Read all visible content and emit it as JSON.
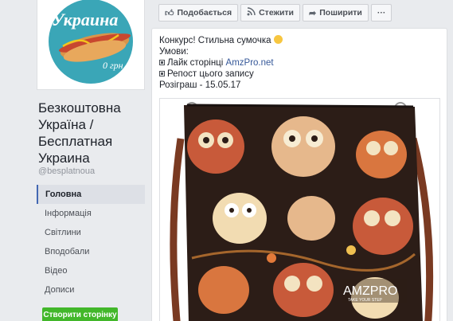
{
  "profile": {
    "logo_text": "Украина",
    "logo_subtext": "0 грн",
    "name": "Безкоштовна Україна / Бесплатная Украина",
    "handle": "@besplatnoua"
  },
  "nav": {
    "items": [
      {
        "label": "Головна",
        "active": true
      },
      {
        "label": "Інформація"
      },
      {
        "label": "Світлини"
      },
      {
        "label": "Вподобали"
      },
      {
        "label": "Відео"
      },
      {
        "label": "Дописи"
      }
    ],
    "create_page": "Створити сторінку"
  },
  "actions": {
    "like": "Подобається",
    "follow": "Стежити",
    "share": "Поширити",
    "more": "···"
  },
  "post": {
    "line1": "Конкурс! Стильна сумочка",
    "line2": "Умови:",
    "line3_prefix": "Лайк сторінці",
    "line3_link": "AmzPro.net",
    "line4": "Репост цього запису",
    "line5": "Розіграш - 15.05.17",
    "watermark": "AMZPRO",
    "watermark_sub": "TAKE YOUR STEP"
  },
  "colors": {
    "brand_blue": "#4267b2",
    "link": "#365899",
    "green_button": "#42b72a",
    "logo_bg": "#3aa6b7"
  }
}
